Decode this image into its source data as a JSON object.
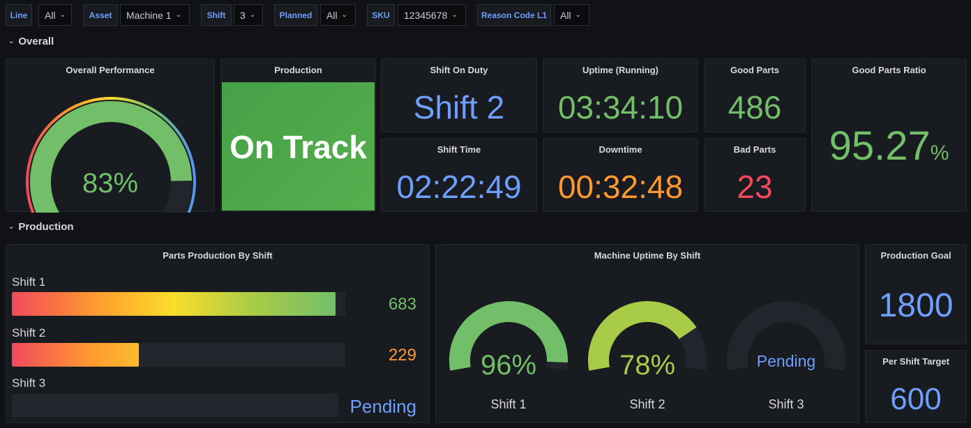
{
  "variables": [
    {
      "label": "Line",
      "value": "All"
    },
    {
      "label": "Asset",
      "value": "Machine 1"
    },
    {
      "label": "Shift",
      "value": "3"
    },
    {
      "label": "Planned",
      "value": "All"
    },
    {
      "label": "SKU",
      "value": "12345678"
    },
    {
      "label": "Reason Code L1",
      "value": "All"
    }
  ],
  "rows": {
    "overall": "Overall",
    "production": "Production"
  },
  "panels": {
    "overall_performance": {
      "title": "Overall Performance",
      "value": "83%",
      "fraction": 0.83
    },
    "production_status": {
      "title": "Production",
      "value": "On Track",
      "color": "#4caf50"
    },
    "shift_on_duty": {
      "title": "Shift On Duty",
      "value": "Shift 2"
    },
    "uptime": {
      "title": "Uptime (Running)",
      "value": "03:34:10"
    },
    "good_parts": {
      "title": "Good Parts",
      "value": "486"
    },
    "good_parts_ratio": {
      "title": "Good Parts Ratio",
      "value": "95.27",
      "unit": "%"
    },
    "shift_time": {
      "title": "Shift Time",
      "value": "02:22:49"
    },
    "downtime": {
      "title": "Downtime",
      "value": "00:32:48"
    },
    "bad_parts": {
      "title": "Bad Parts",
      "value": "23"
    },
    "parts_by_shift": {
      "title": "Parts Production By Shift",
      "bars": [
        {
          "label": "Shift 1",
          "value": "683",
          "fraction": 0.97
        },
        {
          "label": "Shift 2",
          "value": "229",
          "fraction": 0.38
        },
        {
          "label": "Shift 3",
          "value": "Pending",
          "fraction": 0
        }
      ]
    },
    "uptime_by_shift": {
      "title": "Machine Uptime By Shift",
      "gauges": [
        {
          "label": "Shift 1",
          "value": "96%",
          "fraction": 0.96,
          "color": "#73bf69"
        },
        {
          "label": "Shift 2",
          "value": "78%",
          "fraction": 0.78,
          "color": "#a8cb48"
        },
        {
          "label": "Shift 3",
          "value": "Pending",
          "fraction": 0,
          "color": "#6e9fff"
        }
      ]
    },
    "production_goal": {
      "title": "Production Goal",
      "value": "1800"
    },
    "per_shift_target": {
      "title": "Per Shift Target",
      "value": "600"
    }
  },
  "colors": {
    "green": "#73bf69",
    "blue": "#6e9fff",
    "orange": "#ff9830",
    "red": "#f2495c"
  }
}
